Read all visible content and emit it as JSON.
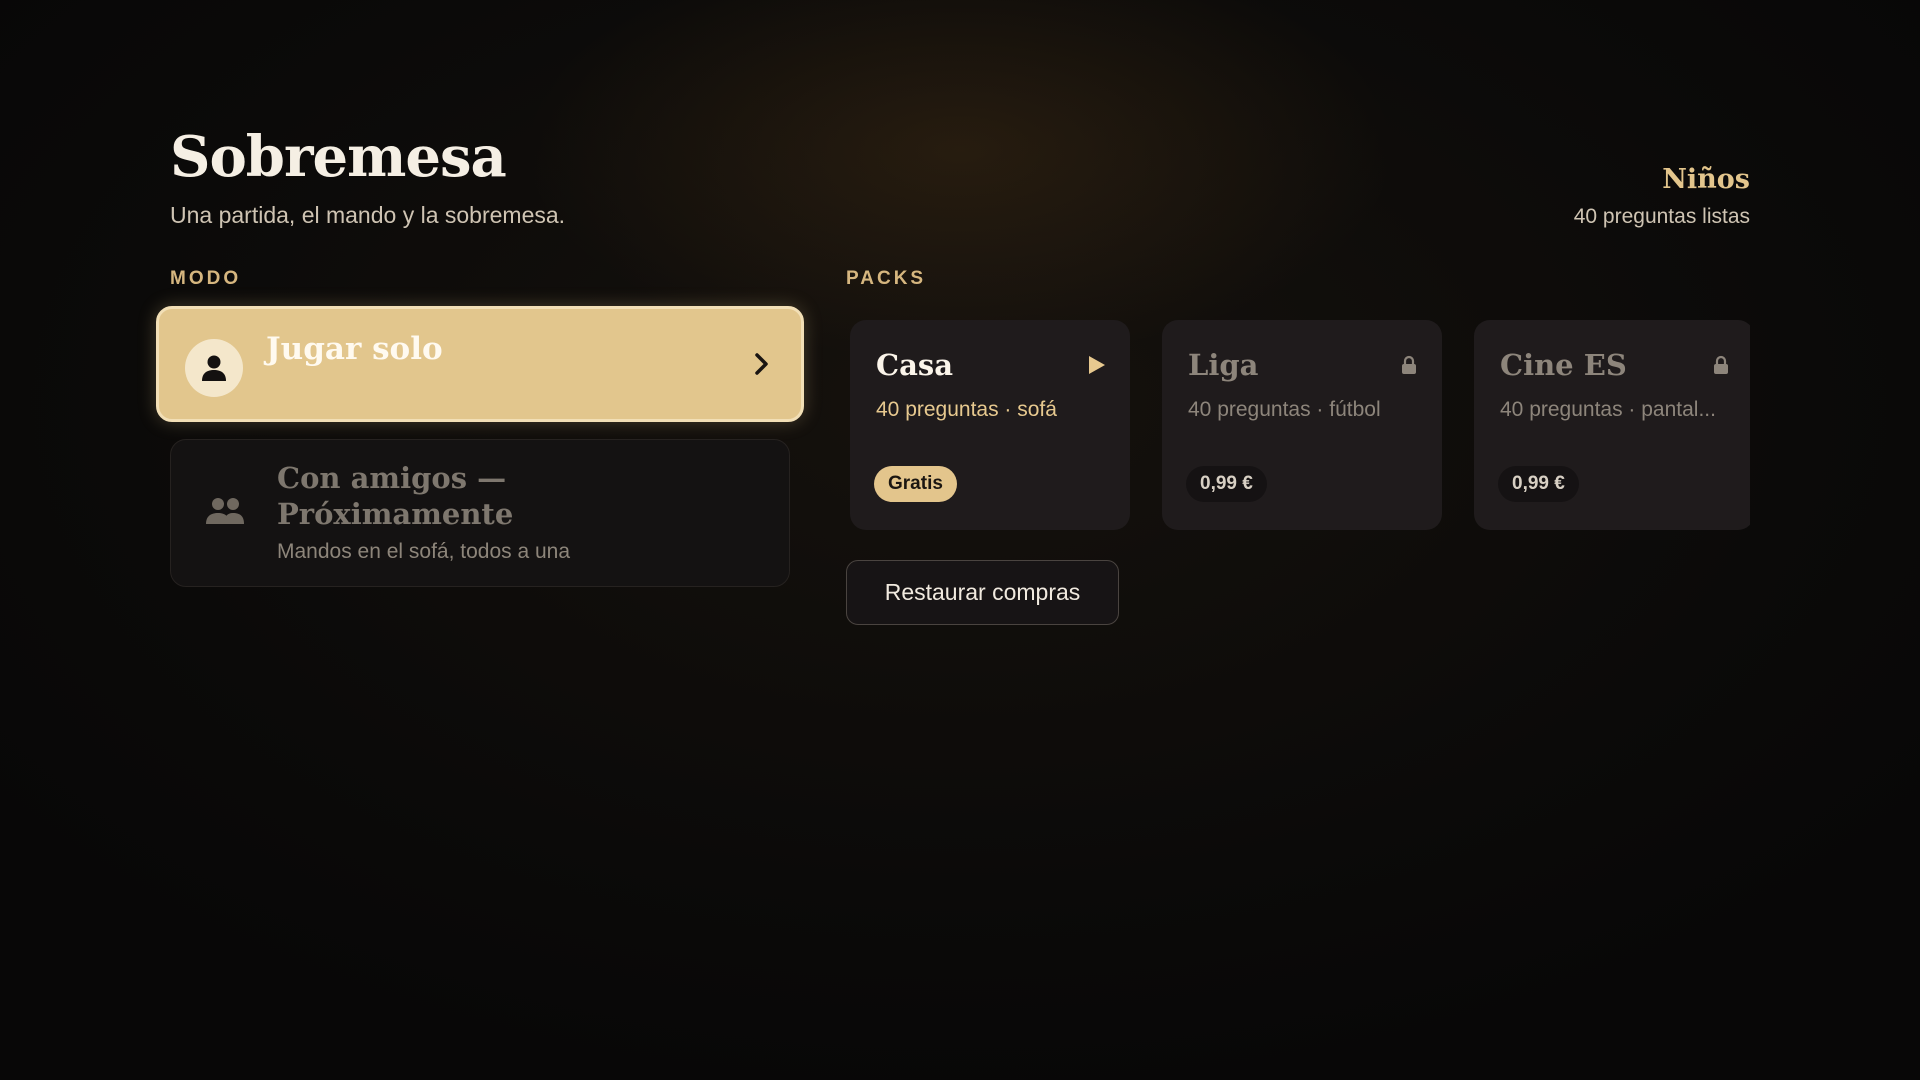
{
  "header": {
    "title": "Sobremesa",
    "subtitle": "Una partida, el mando y la sobremesa."
  },
  "profile": {
    "name": "Niños",
    "status": "40 preguntas listas"
  },
  "modes": {
    "section_label": "MODO",
    "solo": {
      "label": "Jugar solo",
      "icon": "person-icon",
      "selected": true
    },
    "friends": {
      "label": "Con amigos — Próximamente",
      "description": "Mandos en el sofá, todos a una",
      "icon": "group-icon",
      "enabled": false
    }
  },
  "packs": {
    "section_label": "PACKS",
    "items": [
      {
        "name": "Casa",
        "meta": "40 preguntas · sofá",
        "badge": "Gratis",
        "status_icon": "play-icon",
        "locked": false
      },
      {
        "name": "Liga",
        "meta": "40 preguntas · fútbol",
        "badge": "0,99 €",
        "status_icon": "lock-icon",
        "locked": true
      },
      {
        "name": "Cine ES",
        "meta": "40 preguntas · pantal...",
        "badge": "0,99 €",
        "status_icon": "lock-icon",
        "locked": true
      }
    ],
    "restore_label": "Restaurar compras"
  },
  "colors": {
    "accent": "#e2c68d",
    "background": "#0c0a09",
    "card": "#1f1b1c"
  }
}
